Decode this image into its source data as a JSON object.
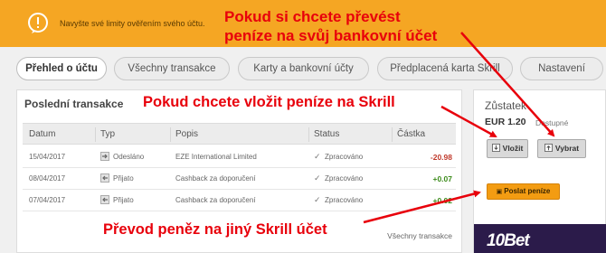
{
  "banner": {
    "icon": "speech-bubble-icon",
    "text": "Navyšte své limity ověřením svého účtu."
  },
  "tabs": [
    {
      "label": "Přehled o účtu",
      "active": true
    },
    {
      "label": "Všechny transakce",
      "active": false
    },
    {
      "label": "Karty a bankovní účty",
      "active": false
    },
    {
      "label": "Předplacená karta Skrill",
      "active": false
    },
    {
      "label": "Nastavení",
      "active": false
    }
  ],
  "transactions": {
    "title": "Poslední transakce",
    "columns": [
      "Datum",
      "Typ",
      "Popis",
      "Status",
      "Částka"
    ],
    "rows": [
      {
        "date": "15/04/2017",
        "type": "Odesláno",
        "description": "EZE International Limited",
        "status": "Zpracováno",
        "amount": "-20.98"
      },
      {
        "date": "08/04/2017",
        "type": "Přijato",
        "description": "Cashback za doporučení",
        "status": "Zpracováno",
        "amount": "+0.07"
      },
      {
        "date": "07/04/2017",
        "type": "Přijato",
        "description": "Cashback za doporučení",
        "status": "Zpracováno",
        "amount": "+0.02"
      }
    ],
    "all_link": "Všechny transakce"
  },
  "balance": {
    "title": "Zůstatek",
    "amount": "EUR 1.20",
    "available": "Dostupné",
    "deposit_label": "Vložit",
    "withdraw_label": "Vybrat",
    "send_label": "Poslat peníze"
  },
  "ad": {
    "text": "10Bet"
  },
  "annotations": {
    "withdraw_line1": "Pokud si chcete převést",
    "withdraw_line2": "peníze na svůj bankovní účet",
    "deposit": "Pokud chcete vložit peníze na Skrill",
    "send": "Převod peněz na jiný Skrill účet"
  },
  "colors": {
    "banner": "#f5a623",
    "annotation": "#e8000b",
    "negative": "#c0392b",
    "positive": "#3d8c1c",
    "send_button": "#f39c12"
  }
}
